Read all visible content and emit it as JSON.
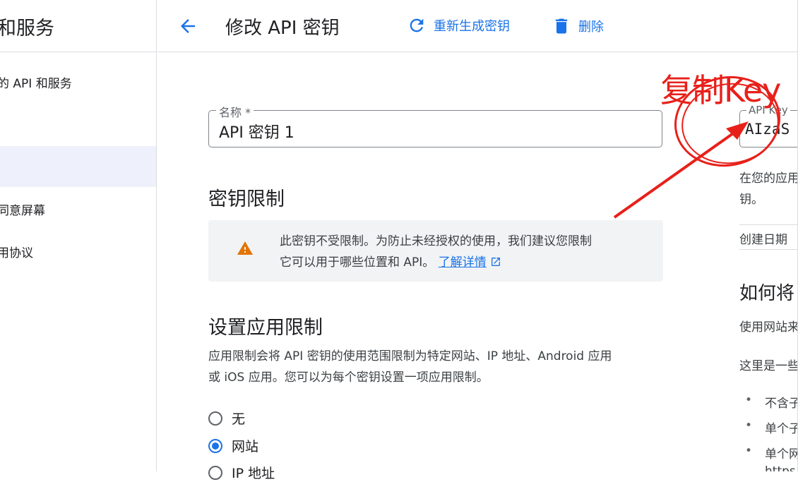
{
  "sidebar": {
    "title": "和服务",
    "items": [
      {
        "label": "的 API 和服务",
        "active": false
      },
      {
        "label": "",
        "active": false
      },
      {
        "label": "",
        "active": true
      },
      {
        "label": "同意屏幕",
        "active": false
      },
      {
        "label": "用协议",
        "active": false
      }
    ]
  },
  "header": {
    "title": "修改 API 密钥",
    "regenerate_label": "重新生成密钥",
    "delete_label": "删除"
  },
  "name_field": {
    "label": "名称 *",
    "value": "API 密钥 1"
  },
  "key_restrictions": {
    "title": "密钥限制",
    "warning_line1": "此密钥不受限制。为防止未经授权的使用，我们建议您限制",
    "warning_line2": "它可以用于哪些位置和 API。",
    "learn_more": "了解详情"
  },
  "app_restrictions": {
    "title": "设置应用限制",
    "desc_line1": "应用限制会将 API 密钥的使用范围限制为特定网站、IP 地址、Android 应用",
    "desc_line2": "或 iOS 应用。您可以为每个密钥设置一项应用限制。",
    "options": [
      {
        "label": "无",
        "checked": false
      },
      {
        "label": "网站",
        "checked": true
      },
      {
        "label": "IP 地址",
        "checked": false
      }
    ]
  },
  "right_panel": {
    "key_label": "API Key",
    "key_value": "AIzaS",
    "help_line1": "在您的应用",
    "help_line2": "钥。",
    "created_label": "创建日期",
    "heading": "如何将",
    "para1": "使用网站来",
    "para2": "这里是一些",
    "bullets": [
      "不含子",
      "单个子",
      "单个网"
    ],
    "trailing": "https"
  },
  "annotation": {
    "text": "复制Key",
    "color": "#e8201a"
  },
  "colors": {
    "accent": "#1a73e8",
    "warning": "#e37400",
    "sidebar_active_bg": "#eef1fb"
  }
}
